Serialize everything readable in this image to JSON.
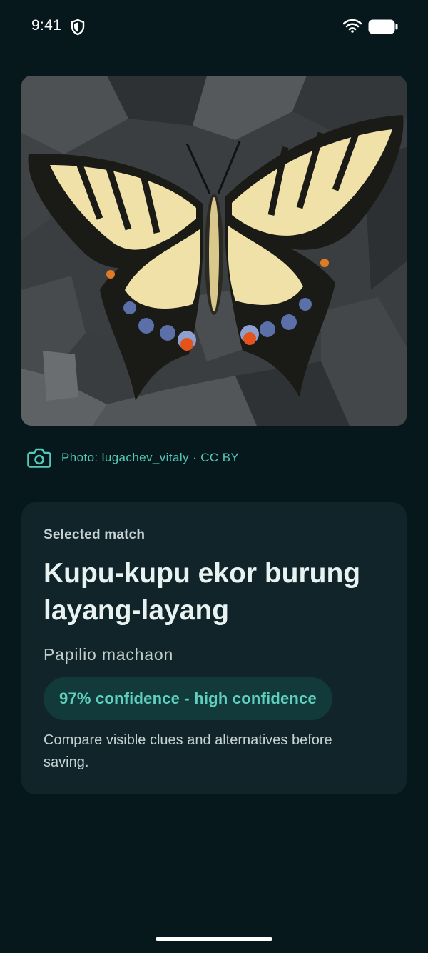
{
  "status_bar": {
    "time": "9:41"
  },
  "photo": {
    "subject": "swallowtail butterfly on dark rocks"
  },
  "credit": {
    "text": "Photo: lugachev_vitaly · CC BY"
  },
  "match_card": {
    "label": "Selected match",
    "common_name": "Kupu-kupu ekor burung layang-layang",
    "scientific_name": "Papilio machaon",
    "confidence": "97% confidence - high confidence",
    "hint": "Compare visible clues and alternatives before saving."
  },
  "colors": {
    "background": "#06181c",
    "card": "#10242a",
    "accent": "#56c9b9",
    "chip": "#133a3a"
  }
}
